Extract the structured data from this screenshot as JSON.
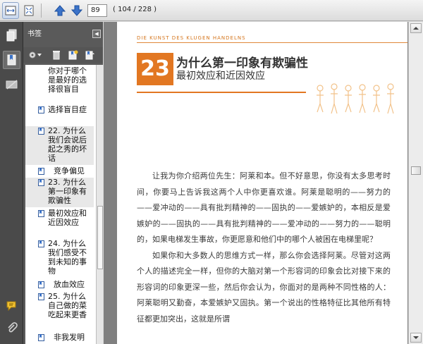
{
  "toolbar": {
    "current_page": "89",
    "page_count_label": "( 104 / 228 )"
  },
  "bookmarks": {
    "title": "书签",
    "items": [
      {
        "label": "你对于哪个是最好的选择很盲目",
        "icon": "bookmark-page-icon"
      },
      {
        "label": "选择盲目症",
        "icon": "bookmark-page-icon"
      },
      {
        "label": "22. 为什么我们会说后起之秀的坏话",
        "icon": "bookmark-page-icon"
      },
      {
        "label": "竞争偏见",
        "icon": "bookmark-page-icon"
      },
      {
        "label": "23. 为什么第一印象有欺骗性",
        "icon": "bookmark-page-icon"
      },
      {
        "label": "最初效应和近因效应",
        "icon": "bookmark-page-icon"
      },
      {
        "label": "24. 为什么我们感受不到未知的事物",
        "icon": "bookmark-page-icon"
      },
      {
        "label": "放血效应",
        "icon": "bookmark-page-icon"
      },
      {
        "label": "25. 为什么自己做的菜吃起来更香",
        "icon": "bookmark-page-icon"
      },
      {
        "label": "非我发明",
        "icon": "bookmark-page-icon"
      }
    ]
  },
  "document": {
    "running_head": "DIE KUNST DES KLUGEN HANDELNS",
    "chapter_number": "23",
    "chapter_title": "为什么第一印象有欺骗性",
    "chapter_subtitle": "最初效应和近因效应",
    "paragraphs": [
      "让我为你介绍两位先生：阿莱和本。但不好意思，你没有太多思考时间，你要马上告诉我这两个人中你更喜欢谁。阿莱是聪明的——努力的——爱冲动的——具有批判精神的——固执的——爱嫉妒的，本相反是爱嫉妒的——固执的——具有批判精神的——爱冲动的——努力的——聪明的，如果电梯发生事故，你更愿意和他们中的哪个人被困在电梯里呢？",
      "如果你和大多数人的思维方式一样，那么你会选择阿莱。尽管对这两个人的描述完全一样，但你的大脑对第一个形容词的印象会比对接下来的形容词的印象更深一些，然后你会认为，你面对的是两种不同性格的人：阿莱聪明又勤奋，本爱嫉妒又固执。第一个说出的性格特征比其他所有特征都更加突出，这就是所谓"
    ]
  },
  "colors": {
    "accent": "#e27722",
    "panel_bg": "#5a5a5a",
    "doc_bg": "#808080"
  }
}
